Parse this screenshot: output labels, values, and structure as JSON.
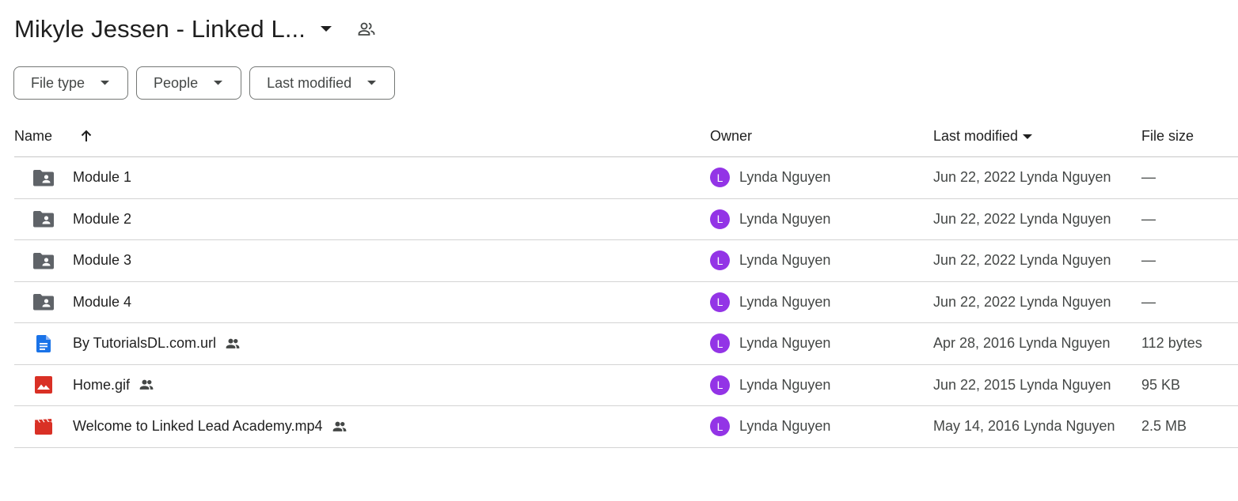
{
  "header": {
    "title": "Mikyle Jessen - Linked L...",
    "title_dropdown_icon": "arrow-drop-down-icon",
    "shared_icon": "people-outline-icon"
  },
  "filters": [
    {
      "label": "File type"
    },
    {
      "label": "People"
    },
    {
      "label": "Last modified"
    }
  ],
  "columns": {
    "name": "Name",
    "owner": "Owner",
    "last_modified": "Last modified",
    "file_size": "File size"
  },
  "rows": [
    {
      "name": "Module 1",
      "icon": "shared-folder-icon",
      "shared": false,
      "owner_initial": "L",
      "owner": "Lynda Nguyen",
      "modified": "Jun 22, 2022 Lynda Nguyen",
      "size": "—"
    },
    {
      "name": "Module 2",
      "icon": "shared-folder-icon",
      "shared": false,
      "owner_initial": "L",
      "owner": "Lynda Nguyen",
      "modified": "Jun 22, 2022 Lynda Nguyen",
      "size": "—"
    },
    {
      "name": "Module 3",
      "icon": "shared-folder-icon",
      "shared": false,
      "owner_initial": "L",
      "owner": "Lynda Nguyen",
      "modified": "Jun 22, 2022 Lynda Nguyen",
      "size": "—"
    },
    {
      "name": "Module 4",
      "icon": "shared-folder-icon",
      "shared": false,
      "owner_initial": "L",
      "owner": "Lynda Nguyen",
      "modified": "Jun 22, 2022 Lynda Nguyen",
      "size": "—"
    },
    {
      "name": "By TutorialsDL.com.url",
      "icon": "docs-file-icon",
      "shared": true,
      "owner_initial": "L",
      "owner": "Lynda Nguyen",
      "modified": "Apr 28, 2016 Lynda Nguyen",
      "size": "112 bytes"
    },
    {
      "name": "Home.gif",
      "icon": "image-file-icon",
      "shared": true,
      "owner_initial": "L",
      "owner": "Lynda Nguyen",
      "modified": "Jun 22, 2015 Lynda Nguyen",
      "size": "95 KB"
    },
    {
      "name": "Welcome to Linked Lead Academy.mp4",
      "icon": "video-file-icon",
      "shared": true,
      "owner_initial": "L",
      "owner": "Lynda Nguyen",
      "modified": "May 14, 2016 Lynda Nguyen",
      "size": "2.5 MB"
    }
  ],
  "colors": {
    "avatar": "#9334e6",
    "folder_icon": "#5f6368",
    "docs_icon": "#1a73e8",
    "image_icon": "#d93025",
    "video_icon": "#d93025"
  }
}
